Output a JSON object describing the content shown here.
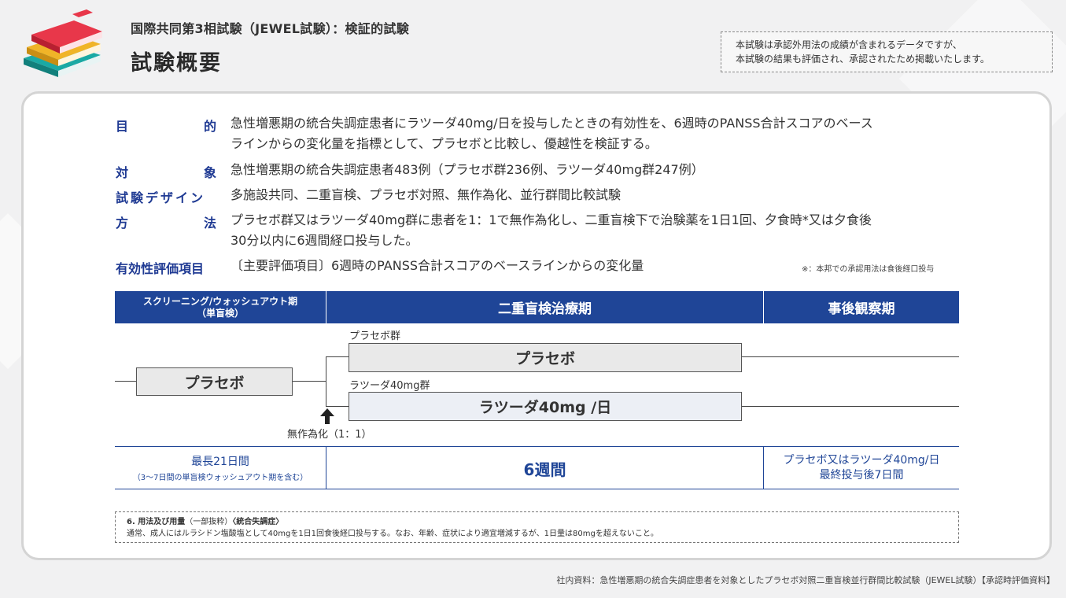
{
  "header": {
    "subtitle": "国際共同第3相試験（JEWEL試験）：検証的試験",
    "title": "試験概要",
    "notice_line1": "本試験は承認外用法の成績が含まれるデータですが、",
    "notice_line2": "本試験の結果も評価され、承認されたため掲載いたします。"
  },
  "summary": {
    "purpose_label": "目　的",
    "purpose_line1": "急性増悪期の統合失調症患者にラツーダ40mg/日を投与したときの有効性を、6週時のPANSS合計スコアのベース",
    "purpose_line2": "ラインからの変化量を指標として、プラセボと比較し、優越性を検証する。",
    "subject_label": "対　象",
    "subject_text": "急性増悪期の統合失調症患者483例（プラセボ群236例、ラツーダ40mg群247例）",
    "design_label": "試験デザイン",
    "design_text": "多施設共同、二重盲検、プラセボ対照、無作為化、並行群間比較試験",
    "method_label": "方　法",
    "method_line1": "プラセボ群又はラツーダ40mg群に患者を1：1で無作為化し、二重盲検下で治験薬を1日1回、夕食時*又は夕食後",
    "method_line2": "30分以内に6週間経口投与した。",
    "endpoint_label": "有効性評価項目",
    "endpoint_text": "〔主要評価項目〕6週時のPANSS合計スコアのベースラインからの変化量",
    "footnote": "※：本邦での承認用法は食後経口投与"
  },
  "timeline": {
    "phase_screening_line1": "スクリーニング/ウォッシュアウト期",
    "phase_screening_line2": "（単盲検）",
    "phase_treatment": "二重盲検治療期",
    "phase_followup": "事後観察期",
    "screening_box": "プラセボ",
    "placebo_group_label": "プラセボ群",
    "placebo_box": "プラセボ",
    "latuda_group_label": "ラツーダ40mg群",
    "latuda_box": "ラツーダ40mg /日",
    "randomization": "無作為化（1：1）",
    "dur_screening_line1": "最長21日間",
    "dur_screening_line2": "（3～7日間の単盲検ウォッシュアウト期を含む）",
    "dur_treatment": "6週間",
    "dur_followup_line1": "プラセボ又はラツーダ40mg/日",
    "dur_followup_line2": "最終投与後7日間"
  },
  "dosage": {
    "heading_bold": "6. 用法及び用量",
    "heading_part": "（一部抜粋）",
    "heading_tail": "〈統合失調症〉",
    "text": "通常、成人にはルラシドン塩酸塩として40mgを1日1回食後経口投与する。なお、年齢、症状により適宜増減するが、1日量は80mgを超えないこと。"
  },
  "footer": {
    "source": "社内資料：急性増悪期の統合失調症患者を対象としたプラセボ対照二重盲検並行群間比較試験（JEWEL試験）【承認時評価資料】"
  },
  "colors": {
    "accent": "#1f4597",
    "label_blue": "#1f3a93"
  },
  "icons": {
    "logo": "stacked-books-icon",
    "arrow": "arrow-up-icon"
  }
}
